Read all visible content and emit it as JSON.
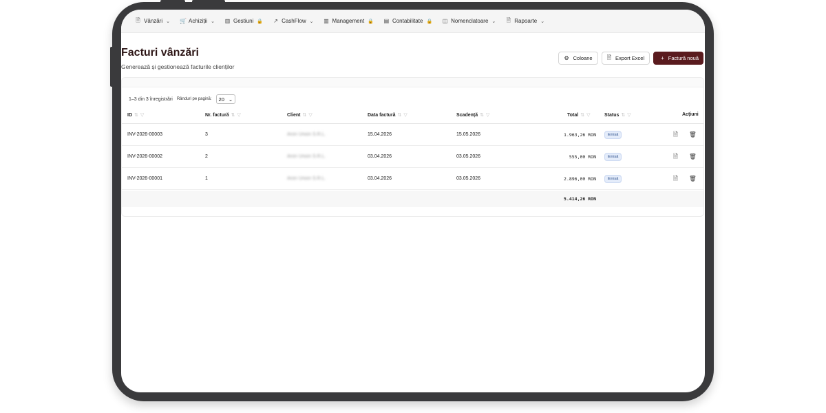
{
  "nav": {
    "items": [
      {
        "label": "Vânzări",
        "icon": "doc-icon",
        "glyph": "🗎",
        "suffix": "chevron"
      },
      {
        "label": "Achiziții",
        "icon": "cart-icon",
        "glyph": "🛒",
        "suffix": "chevron"
      },
      {
        "label": "Gestiuni",
        "icon": "bar-chart-icon",
        "glyph": "▥",
        "suffix": "lock"
      },
      {
        "label": "CashFlow",
        "icon": "trend-icon",
        "glyph": "↗",
        "suffix": "chevron"
      },
      {
        "label": "Management",
        "icon": "bar-chart-icon",
        "glyph": "▥",
        "suffix": "lock"
      },
      {
        "label": "Contabilitate",
        "icon": "ledger-icon",
        "glyph": "▤",
        "suffix": "lock"
      },
      {
        "label": "Nomenclatoare",
        "icon": "book-icon",
        "glyph": "◫",
        "suffix": "chevron"
      },
      {
        "label": "Rapoarte",
        "icon": "doc-icon",
        "glyph": "🗎",
        "suffix": "chevron"
      }
    ]
  },
  "page": {
    "title": "Facturi vânzări",
    "subtitle": "Generează și gestionează facturile clienților"
  },
  "actions": {
    "columns_label": "Coloane",
    "export_label": "Export Excel",
    "new_label": "Factură nouă"
  },
  "table": {
    "records_text": "1–3 din 3 înregistrări",
    "rows_per_page_label": "Rânduri pe pagină:",
    "rows_per_page_value": "20",
    "headers": {
      "id": "ID",
      "number": "Nr. factură",
      "client": "Client",
      "date": "Data factură",
      "due": "Scadență",
      "total": "Total",
      "status": "Status",
      "actions": "Acțiuni"
    },
    "rows": [
      {
        "id": "INV-2026-00003",
        "number": "3",
        "client": "Aron Union S.R.L.",
        "date": "15.04.2026",
        "due": "15.05.2026",
        "total": "1.963,26 RON",
        "status": "Emisă"
      },
      {
        "id": "INV-2026-00002",
        "number": "2",
        "client": "Aron Union S.R.L.",
        "date": "03.04.2026",
        "due": "03.05.2026",
        "total": "555,00 RON",
        "status": "Emisă"
      },
      {
        "id": "INV-2026-00001",
        "number": "1",
        "client": "Aron Union S.R.L.",
        "date": "03.04.2026",
        "due": "03.05.2026",
        "total": "2.896,00 RON",
        "status": "Emisă"
      }
    ],
    "grand_total": "5.414,26 RON"
  },
  "colors": {
    "primary": "#5a1b1e",
    "title": "#2d1616",
    "badge_bg": "#e4ecfa",
    "badge_text": "#2c4f8a"
  }
}
